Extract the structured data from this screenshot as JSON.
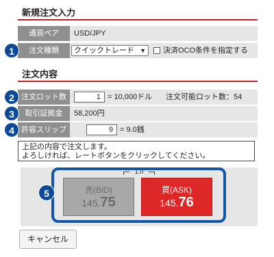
{
  "section1": {
    "title": "新規注文入力"
  },
  "rows1": {
    "currency_pair_label": "通貨ペア",
    "currency_pair_value": "USD/JPY",
    "order_type_label": "注文種類",
    "order_type_value": "クイックトレード",
    "oco_label": "決済OCO条件を指定する"
  },
  "section2": {
    "title": "注文内容"
  },
  "rows2": {
    "lot_label": "注文ロット数",
    "lot_value": "1",
    "lot_unit": "= 10,000ドル",
    "lot_available": "注文可能ロット数：54",
    "margin_label": "取引証拠金",
    "margin_value": "58,200円",
    "slip_label": "許容スリップ",
    "slip_value": "9",
    "slip_unit": "= 9.0銭"
  },
  "message": {
    "line1": "上記の内容で注文します。",
    "line2": "よろしければ、レートボタンをクリックしてください。"
  },
  "spread": "1.0",
  "bid": {
    "label": "売(BID)",
    "price_head": "145.",
    "price_tail": "75"
  },
  "ask": {
    "label": "買(ASK)",
    "price_head": "145.",
    "price_tail": "76"
  },
  "cancel_label": "キャンセル",
  "badges": [
    "1",
    "2",
    "3",
    "4",
    "5"
  ],
  "colors": {
    "badge": "#0c4a98",
    "accent_line": "#cc1e1e",
    "ask": "#de2727",
    "bid": "#a8a8a8"
  }
}
